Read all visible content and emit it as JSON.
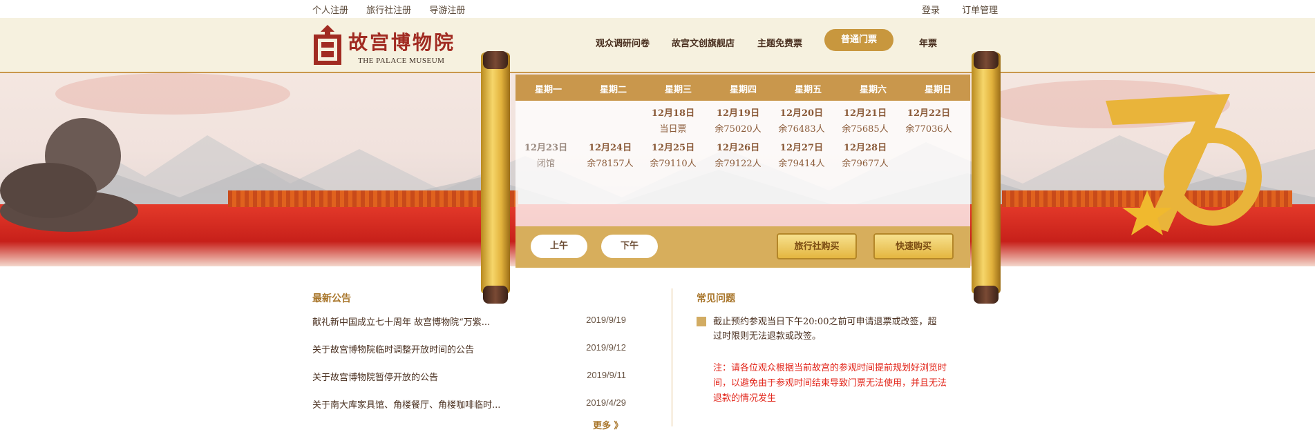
{
  "topbar": {
    "left_links": [
      "个人注册",
      "旅行社注册",
      "导游注册"
    ],
    "right_links": [
      "登录",
      "订单管理"
    ]
  },
  "logo": {
    "cn": "故宫博物院",
    "en": "THE PALACE MUSEUM"
  },
  "nav": {
    "items": [
      "观众调研问卷",
      "故宫文创旗舰店",
      "主题免费票",
      "普通门票",
      "年票"
    ],
    "active_index": 3
  },
  "calendar": {
    "weekdays": [
      "星期一",
      "星期二",
      "星期三",
      "星期四",
      "星期五",
      "星期六",
      "星期日"
    ],
    "row1": [
      {
        "date": "12月18日",
        "remain": "当日票"
      },
      {
        "date": "12月19日",
        "remain": "余75020人"
      },
      {
        "date": "12月20日",
        "remain": "余76483人"
      },
      {
        "date": "12月21日",
        "remain": "余75685人"
      },
      {
        "date": "12月22日",
        "remain": "余77036人"
      }
    ],
    "row2": [
      {
        "date": "12月23日",
        "remain": "闭馆"
      },
      {
        "date": "12月24日",
        "remain": "余78157人"
      },
      {
        "date": "12月25日",
        "remain": "余79110人"
      },
      {
        "date": "12月26日",
        "remain": "余79122人"
      },
      {
        "date": "12月27日",
        "remain": "余79414人"
      },
      {
        "date": "12月28日",
        "remain": "余79677人"
      }
    ]
  },
  "buttons": {
    "morning": "上午",
    "afternoon": "下午",
    "agency_buy": "旅行社购买",
    "quick_buy": "快速购买"
  },
  "news": {
    "title": "最新公告",
    "items": [
      {
        "text": "献礼新中国成立七十周年 故宫博物院“万紫...",
        "date": "2019/9/19"
      },
      {
        "text": "关于故宫博物院临时调整开放时间的公告",
        "date": "2019/9/12"
      },
      {
        "text": "关于故宫博物院暂停开放的公告",
        "date": "2019/9/11"
      },
      {
        "text": "关于南大库家具馆、角楼餐厅、角楼咖啡临时...",
        "date": "2019/4/29"
      }
    ],
    "more": "更多 》"
  },
  "faq": {
    "title": "常见问题",
    "text": "截止预约参观当日下午20:00之前可申请退票或改签，超过时限则无法退款或改签。",
    "note": "注：请各位观众根据当前故宫的参观时间提前规划好浏览时间，以避免由于参观时间结束导致门票无法使用，并且无法退款的情况发生"
  },
  "colors": {
    "gold": "#c8973e",
    "header_bg": "#f6f1df",
    "red_note": "#e2261b"
  }
}
